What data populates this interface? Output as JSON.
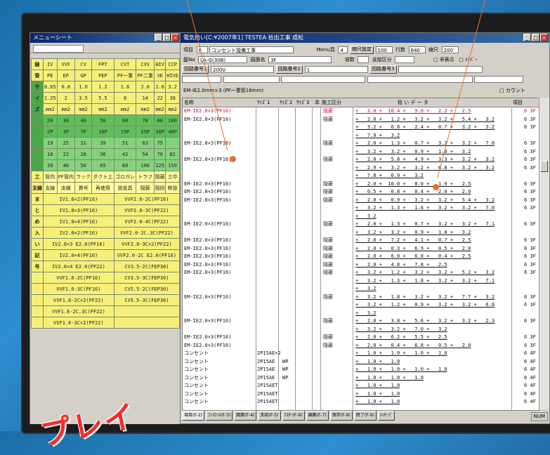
{
  "left_window": {
    "title": "メニューシート",
    "header_row": [
      "IV",
      "VVF",
      "CV",
      "FPT",
      "CVT",
      "CVV",
      "HIV",
      "CCP"
    ],
    "sub_row": [
      "PE",
      "EP",
      "GP",
      "FEP",
      "PF一重",
      "PF二重",
      "VE",
      "HIVE",
      "CD"
    ],
    "side_labels": {
      "top": "線",
      "mid": "管",
      "bottom": "サ",
      "z": "イ",
      "zz": "ズ"
    },
    "num_rows": [
      [
        "0.65",
        "0.8",
        "1.0",
        "1.2",
        "1.6",
        "2.0",
        "2.6",
        "3.2",
        "4"
      ],
      [
        "1.25",
        "2",
        "3.5",
        "5.5",
        "8",
        "14",
        "22",
        "38",
        "60"
      ],
      [
        "mm2",
        "mm2",
        "mm2",
        "mm2",
        "mm2",
        "mm2",
        "mm2",
        "mm2",
        "mm2"
      ],
      [
        "20",
        "30",
        "40",
        "50",
        "60",
        "70",
        "80",
        "100",
        "12"
      ],
      [
        "2P",
        "3P",
        "7P",
        "10P",
        "15P",
        "25P",
        "30P",
        "40P",
        "50"
      ],
      [
        "19",
        "25",
        "31",
        "39",
        "51",
        "63",
        "75",
        ""
      ],
      [
        "16",
        "22",
        "28",
        "36",
        "42",
        "54",
        "70",
        "82",
        "92"
      ],
      [
        "30",
        "40",
        "50",
        "65",
        "80",
        "100",
        "125",
        "150",
        "20"
      ]
    ],
    "work_row": [
      "管内",
      "PF管内",
      "ラック",
      "ダクト上",
      "ゴロガレ",
      "トラフ",
      "隠蔽",
      "土中",
      "露"
    ],
    "work_row2": [
      "支線",
      "支線",
      "貫号",
      "再使用",
      "放金具",
      "隠蔽",
      "隠段",
      "移設",
      "建柱"
    ],
    "work_side": [
      "工",
      "支線"
    ],
    "lower_side": [
      "ま",
      "と",
      "め",
      "入",
      "い",
      "記",
      "号"
    ],
    "lower_items": [
      [
        "IV1.6×2(PF16)",
        "VVF2.0-2C(PF16)"
      ],
      [
        "IV1.8×3(PF16)",
        "VVF2.0-3C(PF22)"
      ],
      [
        "IV1.8×4(PF16)",
        "VVF2.0-4C(PF22)"
      ],
      [
        "IV2.0×2(PF16)",
        "VVF2.0-2C.3C(PF22)"
      ],
      [
        "IV2.0×3 E2.0(PF16)",
        "VVF2.0-3C×2(PF22)"
      ],
      [
        "IV2.0×4(PF16)",
        "VVF2.0-2C E2.0(PF16)"
      ],
      [
        "IV2.0×4 E2.0(PF22)",
        "CV3.5-2C(FEP30)"
      ],
      [
        "VVF1.6-2C(PF16)",
        "CV3.5-3C(FEP30)"
      ],
      [
        "VVF1.6-3C(PF16)",
        "CV5.5-2C(FEP30)"
      ],
      [
        "VVF1.6-2C×2(PF22)",
        "CV5.5-3C(FEP30)"
      ],
      [
        "VVF1.6-2C.3C(PF22)",
        ""
      ],
      [
        "VVF1.6-3C×2(PF22)",
        ""
      ]
    ]
  },
  "main_window": {
    "title": "電気拾い[C:¥2007年1] TESTEA 拾出工事 成松",
    "row1": {
      "item_label": "項目",
      "item_num": "8",
      "item_name": "コンセント設備工事",
      "menu_label": "Menu頁",
      "menu_num": "4",
      "scale_label": "縮尺設定",
      "scale_val": "100",
      "rows_label": "行数",
      "rows_val": "640",
      "shrink_label": "縮尺",
      "shrink_val": "200"
    },
    "row2": {
      "no_label": "盤No",
      "no_val": "LA-G(30B)",
      "drawing_label": "図面名",
      "drawing_val": "3F",
      "ratio_label": "倍数",
      "kbn_label": "支給区分",
      "nonshow": "非表示",
      "member": "ﾒﾝﾊﾞｰ"
    },
    "row3": {
      "circ1_label": "回路番号1",
      "circ1_val": "200V",
      "circ2_label": "回路番号2",
      "circ2_val": "1",
      "circ3_label": "回路番号3",
      "circ3_val": ""
    },
    "head_note": "EM-IE2.0mm×3 (PF一重管16mm)",
    "count_label": "カウント",
    "col_headers": {
      "name": "名称",
      "size1": "ｻｲｽﾞ1",
      "size2": "ｻｲｽﾞ2",
      "size3": "ｻｲｽﾞ3",
      "hon": "本",
      "class": "施工区分",
      "data": "拾 い デ ー タ",
      "item": "項目"
    },
    "lines": [
      {
        "name": "EM-IE2.0×3(PF16)",
        "cls": "隠蔽",
        "data": "+   2.0 +  10.4 +   9.0 +   2.2 +   2.5",
        "rg": "6 3F",
        "sel": true
      },
      {
        "name": "EM-IE2.0×3(PF16)",
        "cls": "隠蔽",
        "data": "+   2.0 +   1.2 +   3.2 +   3.2 +   5.4 +   3.2",
        "rg": "6 3F"
      },
      {
        "name": "",
        "cls": "",
        "data": "+   3.2 +   0.8 +   2.4 +   0.7 +   3.2 +   3.2",
        "rg": "6 3F"
      },
      {
        "name": "",
        "cls": "",
        "data": "+   7.9 +   3.2",
        "rg": ""
      },
      {
        "name": "EM-IE2.0×3(PF16)",
        "cls": "隠蔽",
        "data": "+   2.0 +   1.3 +   0.7 +   3.2 +   3.2 +   7.0",
        "rg": "6 3F"
      },
      {
        "name": "",
        "cls": "",
        "data": "+   3.2 +   3.2 +   0.9 +   1.0 +   3.2",
        "rg": "6 3F"
      },
      {
        "name": "EM-IE2.0×3(PF16)",
        "cls": "隠蔽",
        "data": "+   2.0 +   5.8 +   4.9 +   3.3 +   3.2 +   3.2",
        "rg": "6 3F"
      },
      {
        "name": "",
        "cls": "",
        "data": "+   2.9 +   3.2 +   3.2 +   6.8 +   3.2 +   3.2",
        "rg": "6 3F"
      },
      {
        "name": "",
        "cls": "",
        "data": "+   7.8 +   0.9 +   3.2",
        "rg": ""
      },
      {
        "name": "EM-IE2.0×3(PF16)",
        "cls": "隠蔽",
        "data": "+   2.0 +  10.0 +   8.0 +   1.9 +   2.5",
        "rg": "6 3F"
      },
      {
        "name": "EM-IE2.0×3(PF16)",
        "cls": "隠蔽",
        "data": "+   0.5 +   0.8 +   0.4 +   2.0 +   2.0",
        "rg": "6 3F"
      },
      {
        "name": "EM-IE2.0×3(PF16)",
        "cls": "隠蔽",
        "data": "+   2.0 +   0.9 +   3.2 +   3.2 +   5.4 +   3.2",
        "rg": "6 3F"
      },
      {
        "name": "",
        "cls": "",
        "data": "+   3.2 +   1.3 +   1.6 +   3.2 +   3.2 +   7.0",
        "rg": "6 3F"
      },
      {
        "name": "",
        "cls": "",
        "data": "+   3.2",
        "rg": ""
      },
      {
        "name": "EM-IE2.0×3(PF16)",
        "cls": "隠蔽",
        "data": "+   2.0 +   1.3 +   0.7 +   3.2 +   3.2 +   7.1",
        "rg": "6 3F"
      },
      {
        "name": "",
        "cls": "",
        "data": "+   3.2 +   3.2 +   0.9 +   1.0 +   3.2",
        "rg": ""
      },
      {
        "name": "EM-IE2.0×3(PF16)",
        "cls": "隠蔽",
        "data": "+   2.0 +   7.2 +   4.1 +   0.7 +   2.5",
        "rg": "6 3F"
      },
      {
        "name": "EM-IE2.0×3(PF16)",
        "cls": "隠蔽",
        "data": "+   2.0 +   0.3 +   6.9 +   0.5 +   2.0",
        "rg": "6 3F"
      },
      {
        "name": "EM-IE2.0×3(PF16)",
        "cls": "隠蔽",
        "data": "+   2.0 +   6.0 +   6.0 +   0.4 +   2.5",
        "rg": "6 3F"
      },
      {
        "name": "EM-IE2.0×3(PF16)",
        "cls": "隠蔽",
        "data": "+   2.0 +   4.8 +   7.8 +   2.5",
        "rg": "6 3F"
      },
      {
        "name": "EM-IE2.0×3(PF16)",
        "cls": "隠蔽",
        "data": "+   3.2 +   1.2 +   3.2 +   3.2 +   5.2 +   3.2",
        "rg": "6 3F"
      },
      {
        "name": "",
        "cls": "",
        "data": "+   3.2 +   1.3 +   1.8 +   3.2 +   3.2 +   7.1",
        "rg": ""
      },
      {
        "name": "",
        "cls": "",
        "data": "+   3.2",
        "rg": ""
      },
      {
        "name": "EM-IE2.0×3(PF16)",
        "cls": "隠蔽",
        "data": "+   3.2 +   1.8 +   3.2 +   3.2 +   7.7 +   3.2",
        "rg": "6 3F"
      },
      {
        "name": "",
        "cls": "",
        "data": "+   3.2 +   1.2 +   0.9 +   3.2 +   3.2 +   6.8",
        "rg": "6 3F"
      },
      {
        "name": "",
        "cls": "",
        "data": "+   3.2",
        "rg": ""
      },
      {
        "name": "EM-IE2.0×3(PF16)",
        "cls": "隠蔽",
        "data": "+   2.0 +   3.8 +   5.6 +   3.2 +   3.2 +   2.3",
        "rg": "6 3F"
      },
      {
        "name": "",
        "cls": "",
        "data": "+   3.2 +   3.2 +   7.0 +   3.2",
        "rg": ""
      },
      {
        "name": "EM-IE2.0×3(PF16)",
        "cls": "隠蔽",
        "data": "+   2.0 +   6.2 +   5.5 +   2.5",
        "rg": "6 3F"
      },
      {
        "name": "EM-IE2.0×3(PF16)",
        "cls": "隠蔽",
        "data": "+   2.0 +   0.4 +   6.8 +   0.5 +   2.0",
        "rg": "6 3F"
      },
      {
        "name": "コンセント",
        "sz": "2P15AE×2",
        "ex": "",
        "cls": "",
        "data": "+   1.0 +   1.0 +   1.0 +   1.0",
        "rg": "6 4F"
      },
      {
        "name": "コンセント",
        "sz": "2P15AE",
        "ex": "WP",
        "cls": "",
        "data": "+   1.0 +   1.0",
        "rg": "6 4F"
      },
      {
        "name": "コンセント",
        "sz": "2P15AE",
        "ex": "WP",
        "cls": "",
        "data": "+   1.0 +   1.0 +   1.0 +   1.0",
        "rg": "6 4F"
      },
      {
        "name": "コンセント",
        "sz": "2P15AE",
        "ex": "WP",
        "cls": "",
        "data": "+   1.0 +   1.0 +   1.0",
        "rg": "6 4F"
      },
      {
        "name": "コンセント",
        "sz": "2P15AET",
        "ex": "",
        "cls": "",
        "data": "+   1.0 +   1.0",
        "rg": "6 4F"
      },
      {
        "name": "コンセント",
        "sz": "2P15AET",
        "ex": "",
        "cls": "",
        "data": "+   1.0 +   1.0",
        "rg": "6 4F"
      },
      {
        "name": "コンセント",
        "sz": "2P15AET",
        "ex": "",
        "cls": "",
        "data": "+   1.0 +   1.0",
        "rg": "6 4F"
      }
    ],
    "tabs": [
      "項目(F-2)",
      "ｺﾝﾄﾛｰﾙ(F-3)",
      "図面(F-4)",
      "支給(F-5)",
      "ﾏｽﾀｰ(F-6)",
      "編集(F-7)",
      "保存(F-8)",
      "終了(F-9)",
      "ﾒｯｾｰｼﾞ"
    ],
    "status": [
      "NUM"
    ]
  },
  "promo_text": "プレイ",
  "colors": {
    "accent": "#e8722a",
    "selected": "#d0004a",
    "yellow": "#f6f07a",
    "green": "#5fbf5a"
  }
}
